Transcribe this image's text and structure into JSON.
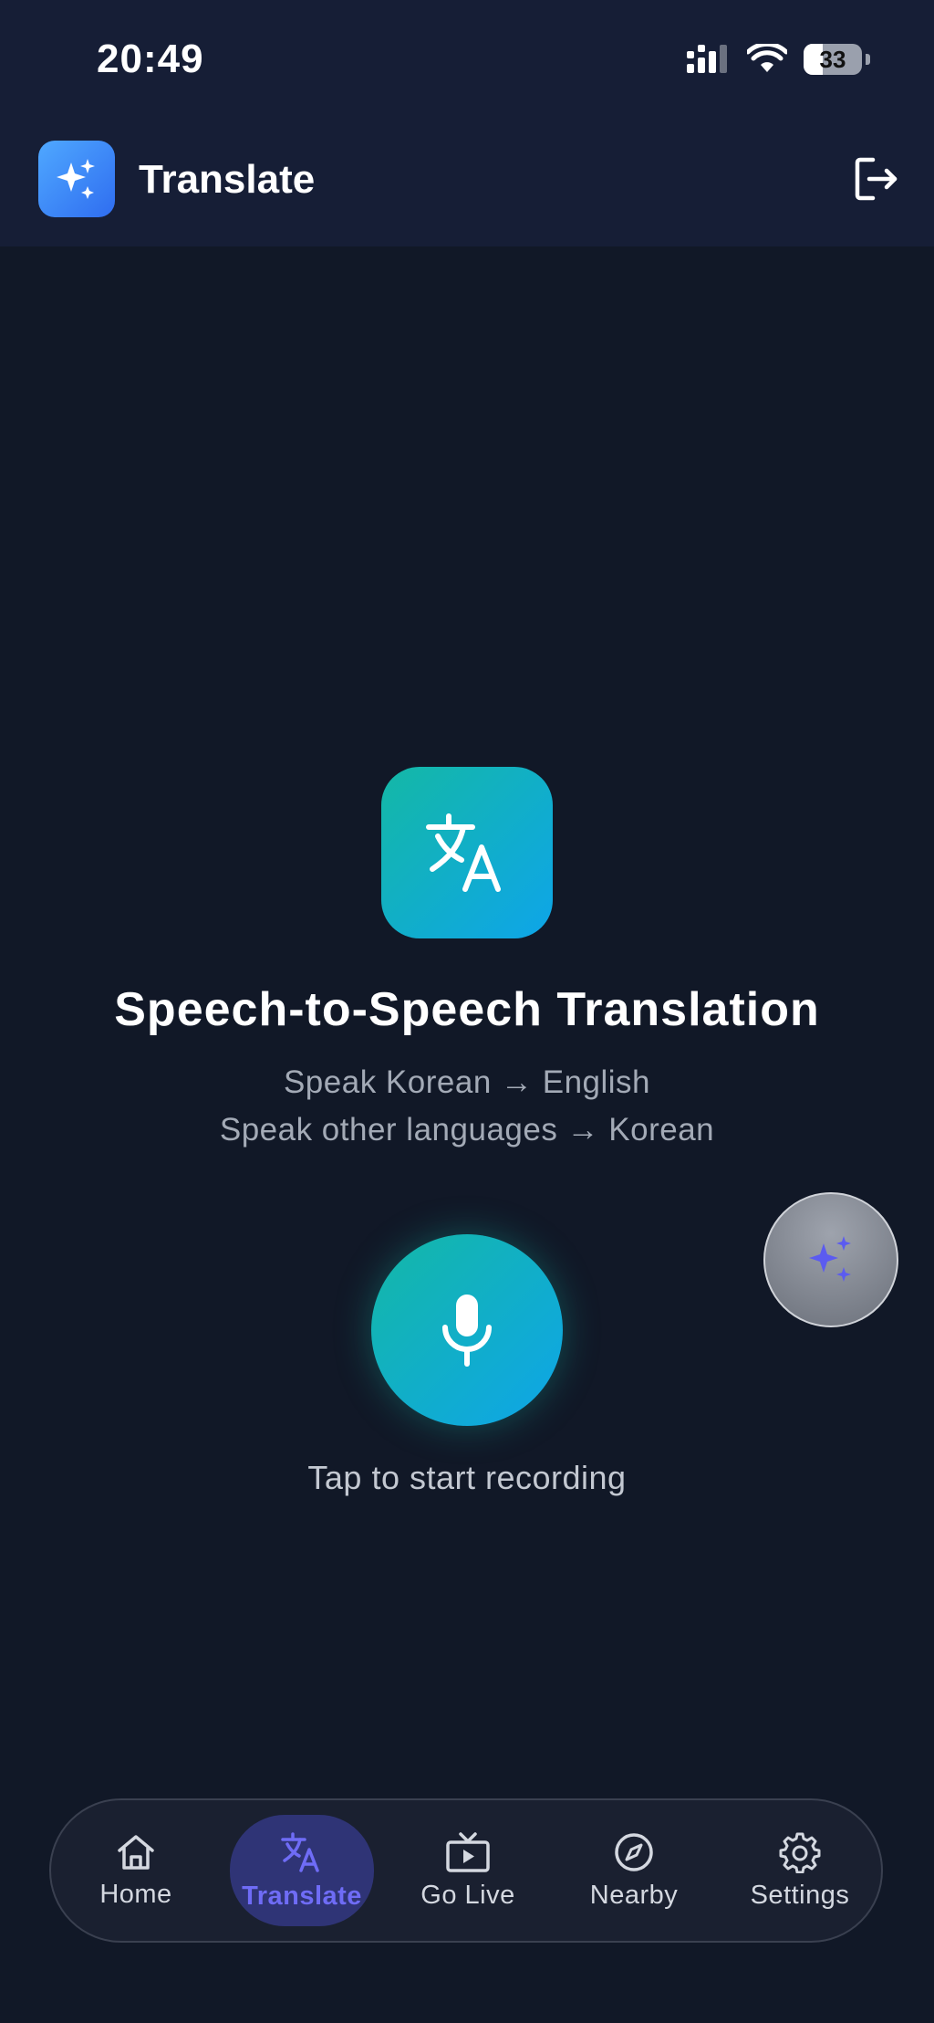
{
  "status_bar": {
    "time": "20:49",
    "battery_level": "33"
  },
  "header": {
    "title": "Translate"
  },
  "hero": {
    "title": "Speech-to-Speech Translation",
    "subtitle_line1": "Speak Korean → English",
    "subtitle_line2": "Speak other languages → Korean"
  },
  "recorder": {
    "caption": "Tap to start recording"
  },
  "bottom_nav": {
    "items": [
      {
        "label": "Home",
        "icon": "home-icon"
      },
      {
        "label": "Translate",
        "icon": "translate-icon",
        "active": true
      },
      {
        "label": "Go Live",
        "icon": "tv-play-icon"
      },
      {
        "label": "Nearby",
        "icon": "compass-icon"
      },
      {
        "label": "Settings",
        "icon": "gear-icon"
      }
    ]
  },
  "colors": {
    "background": "#111827",
    "header": "#161e36",
    "accent_teal": "#14b8a6",
    "accent_blue": "#0ea5e9",
    "nav_active": "#6f6cf6"
  }
}
